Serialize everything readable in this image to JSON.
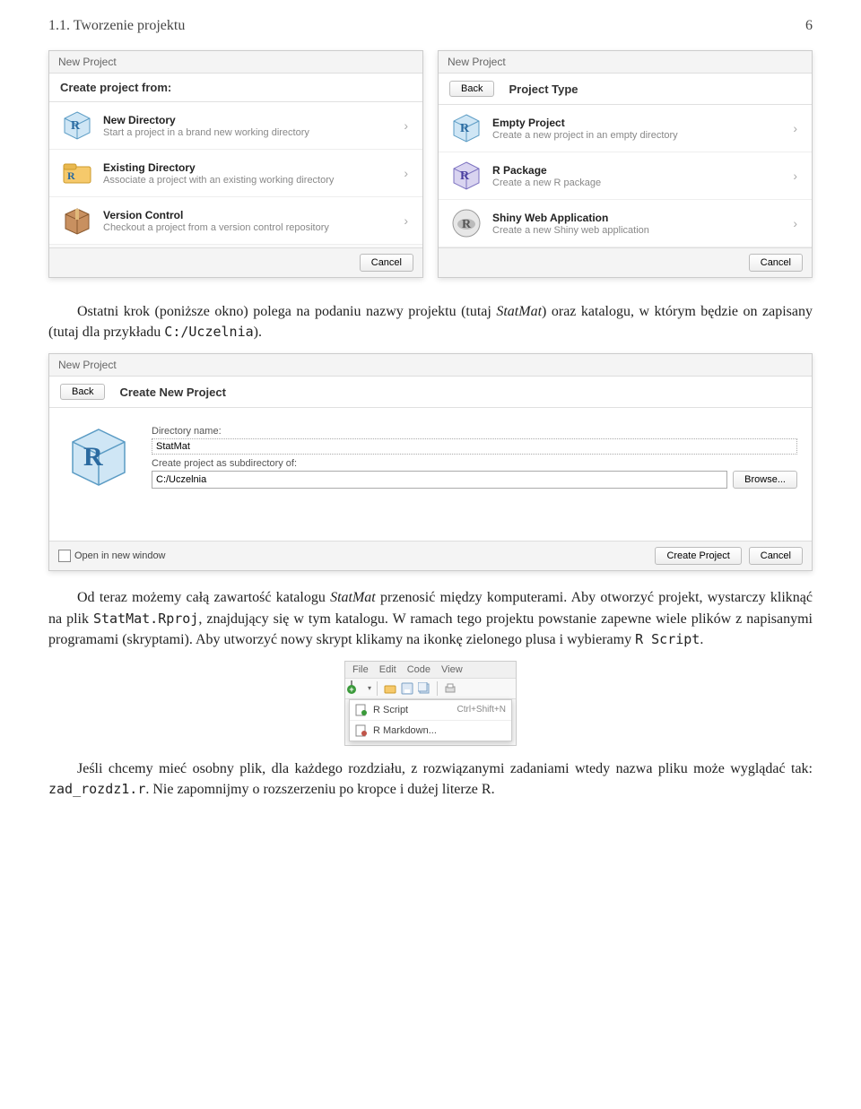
{
  "header": {
    "left": "1.1. Tworzenie projektu",
    "page": "6"
  },
  "dlg1": {
    "win": "New Project",
    "head": "Create project from:",
    "opts": [
      {
        "title": "New Directory",
        "sub": "Start a project in a brand new working directory"
      },
      {
        "title": "Existing Directory",
        "sub": "Associate a project with an existing working directory"
      },
      {
        "title": "Version Control",
        "sub": "Checkout a project from a version control repository"
      }
    ],
    "cancel": "Cancel"
  },
  "dlg2": {
    "win": "New Project",
    "back": "Back",
    "head": "Project Type",
    "opts": [
      {
        "title": "Empty Project",
        "sub": "Create a new project in an empty directory"
      },
      {
        "title": "R Package",
        "sub": "Create a new R package"
      },
      {
        "title": "Shiny Web Application",
        "sub": "Create a new Shiny web application"
      }
    ],
    "cancel": "Cancel"
  },
  "para1": {
    "a": "Ostatni krok (poniższe okno) polega na podaniu nazwy projektu (tutaj ",
    "b": "StatMat",
    "c": ") oraz katalogu, w którym będzie on zapisany (tutaj dla przykładu ",
    "d": "C:/Uczelnia",
    "e": ")."
  },
  "dlg3": {
    "win": "New Project",
    "back": "Back",
    "head": "Create New Project",
    "dirLabel": "Directory name:",
    "dirVal": "StatMat",
    "subLabel": "Create project as subdirectory of:",
    "subVal": "C:/Uczelnia",
    "browse": "Browse...",
    "openNew": "Open in new window",
    "create": "Create Project",
    "cancel": "Cancel"
  },
  "para2": {
    "a": "Od teraz możemy całą zawartość katalogu ",
    "b": "StatMat",
    "c": " przenosić między komputerami. Aby otworzyć projekt, wystarczy kliknąć na plik ",
    "d": "StatMat.Rproj",
    "e": ", znajdujący się w tym katalogu. W ramach tego projektu powstanie zapewne wiele plików z napisanymi programami (skryptami). Aby utworzyć nowy skrypt klikamy na ikonkę zielonego plusa i wybieramy ",
    "f": "R Script",
    "g": "."
  },
  "menu": {
    "items": [
      "File",
      "Edit",
      "Code",
      "View"
    ],
    "rscript": "R Script",
    "shortcut": "Ctrl+Shift+N",
    "rmarkdown": "R Markdown..."
  },
  "para3": {
    "a": "Jeśli chcemy mieć osobny plik, dla każdego rozdziału, z rozwiązanymi zadaniami wtedy nazwa pliku może wyglądać tak: ",
    "b": "zad_rozdz1.r",
    "c": ". Nie zapomnijmy o rozszerzeniu po kropce i dużej literze R."
  }
}
